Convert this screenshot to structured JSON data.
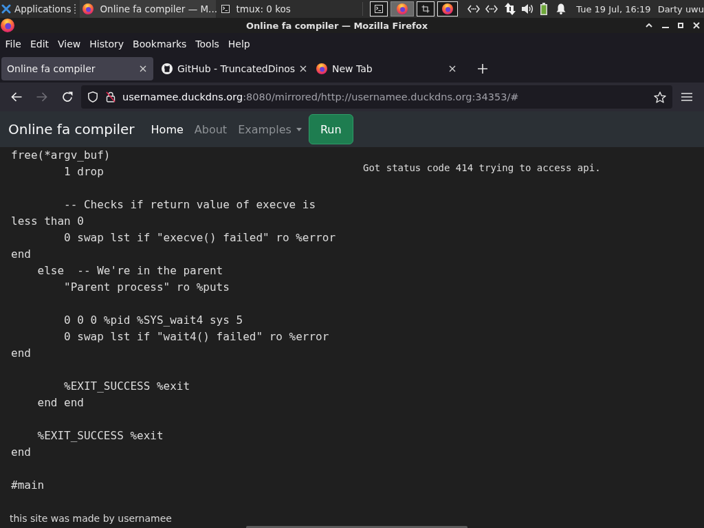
{
  "taskbar": {
    "app_menu": "Applications",
    "windows": [
      {
        "title": "Online fa compiler — M...",
        "kind": "browser",
        "selected": true
      },
      {
        "title": "tmux: 0 kos",
        "kind": "terminal",
        "selected": false
      }
    ],
    "workspaces": [
      {
        "kind": "terminal",
        "selected": false
      },
      {
        "kind": "browser",
        "selected": true
      },
      {
        "kind": "window",
        "selected": false
      },
      {
        "kind": "browser",
        "selected": false
      }
    ],
    "clock": "Tue 19 Jul, 16:19",
    "user": "Darty uwu"
  },
  "window": {
    "title": "Online fa compiler — Mozilla Firefox"
  },
  "menu": [
    "File",
    "Edit",
    "View",
    "History",
    "Bookmarks",
    "Tools",
    "Help"
  ],
  "tabs": [
    {
      "label": "Online fa compiler",
      "kind": "plain",
      "selected": true
    },
    {
      "label": "GitHub - TruncatedDinos",
      "kind": "github",
      "selected": false
    },
    {
      "label": "New Tab",
      "kind": "browser",
      "selected": false
    }
  ],
  "toolbar": {
    "buttons": [
      {
        "kind": "back",
        "disabled": false
      },
      {
        "kind": "forward",
        "disabled": true
      },
      {
        "kind": "reload",
        "disabled": false
      }
    ],
    "url": {
      "host": "usernamee.duckdns.org",
      "rest": ":8080/mirrored/http://usernamee.duckdns.org:34353/#"
    }
  },
  "page": {
    "brand": "Online fa compiler",
    "nav": [
      {
        "label": "Home",
        "selected": true,
        "dropdown": false
      },
      {
        "label": "About",
        "selected": false,
        "dropdown": false
      },
      {
        "label": "Examples",
        "selected": false,
        "dropdown": true
      }
    ],
    "run_button": "Run",
    "code": "free(*argv_buf)\n        1 drop\n\n        -- Checks if return value of execve is\nless than 0\n        0 swap lst if \"execve() failed\" ro %error\nend\n    else  -- We're in the parent\n        \"Parent process\" ro %puts\n\n        0 0 0 %pid %SYS_wait4 sys 5\n        0 swap lst if \"wait4() failed\" ro %error\nend\n\n        %EXIT_SUCCESS %exit\n    end end\n\n    %EXIT_SUCCESS %exit\nend\n\n#main",
    "output": "Got status code 414 trying to access api.",
    "footer": "this site was made by usernamee"
  }
}
